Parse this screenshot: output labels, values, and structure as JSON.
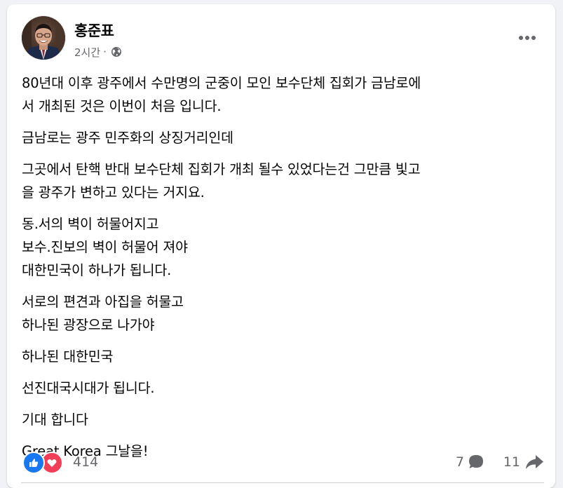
{
  "post": {
    "author": "홍준표",
    "time": "2시간",
    "separator": "·",
    "audience_icon": "globe-icon",
    "more_icon": "more-options-icon",
    "paragraphs": [
      "80년대 이후 광주에서 수만명의 군중이 모인 보수단체 집회가 금남로에\n서 개최된 것은 이번이 처음 입니다.",
      "금남로는 광주 민주화의 상징거리인데",
      "그곳에서 탄핵 반대 보수단체 집회가 개최 될수 있었다는건 그만큼 빛고\n을 광주가 변하고 있다는 거지요.",
      "동.서의 벽이 허물어지고\n보수.진보의 벽이 허물어 져야\n대한민국이 하나가 됩니다.",
      "서로의 편견과 아집을 허물고\n하나된 광장으로 나가야",
      "하나된 대한민국",
      "선진대국시대가 됩니다.",
      "기대 합니다",
      "Great Korea 그날을!"
    ]
  },
  "reactions": {
    "count": "414",
    "icons": [
      "like-icon",
      "love-icon"
    ],
    "like_color": "#1877f2",
    "love_color": "#f33e58"
  },
  "engagement": {
    "comments": "7",
    "comment_icon": "comment-icon",
    "shares": "11",
    "share_icon": "share-icon"
  },
  "colors": {
    "text_primary": "#050505",
    "text_secondary": "#65676b",
    "background": "#f0f2f5",
    "card": "#ffffff"
  }
}
